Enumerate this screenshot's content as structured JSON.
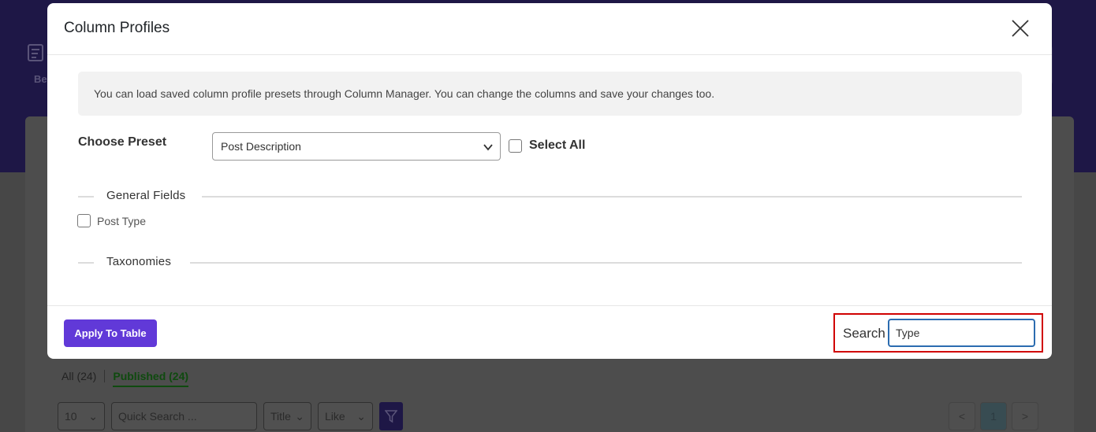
{
  "background": {
    "icon_label": "Be",
    "tabs": [
      {
        "label": "All (24)"
      },
      {
        "label": "Published (24)"
      }
    ],
    "controls": {
      "per_page": "10",
      "quick_search_placeholder": "Quick Search ...",
      "field_select": "Title",
      "operator_select": "Like"
    },
    "pager": {
      "prev": "<",
      "current": "1",
      "next": ">"
    }
  },
  "modal": {
    "title": "Column Profiles",
    "info_text": "You can load saved column profile presets through Column Manager. You can change the columns and save your changes too.",
    "preset": {
      "label": "Choose Preset",
      "selected": "Post Description"
    },
    "select_all_label": "Select All",
    "sections": [
      {
        "title": "General Fields",
        "fields": [
          {
            "label": "Post Type",
            "checked": false
          }
        ]
      },
      {
        "title": "Taxonomies",
        "fields": []
      }
    ],
    "footer": {
      "apply_label": "Apply To Table",
      "search_label": "Search",
      "search_value": "Type"
    }
  },
  "colors": {
    "accent": "#6139d8",
    "highlight_border": "#d00000",
    "input_focus": "#2b6cb0",
    "header_bg": "#1e1746"
  }
}
